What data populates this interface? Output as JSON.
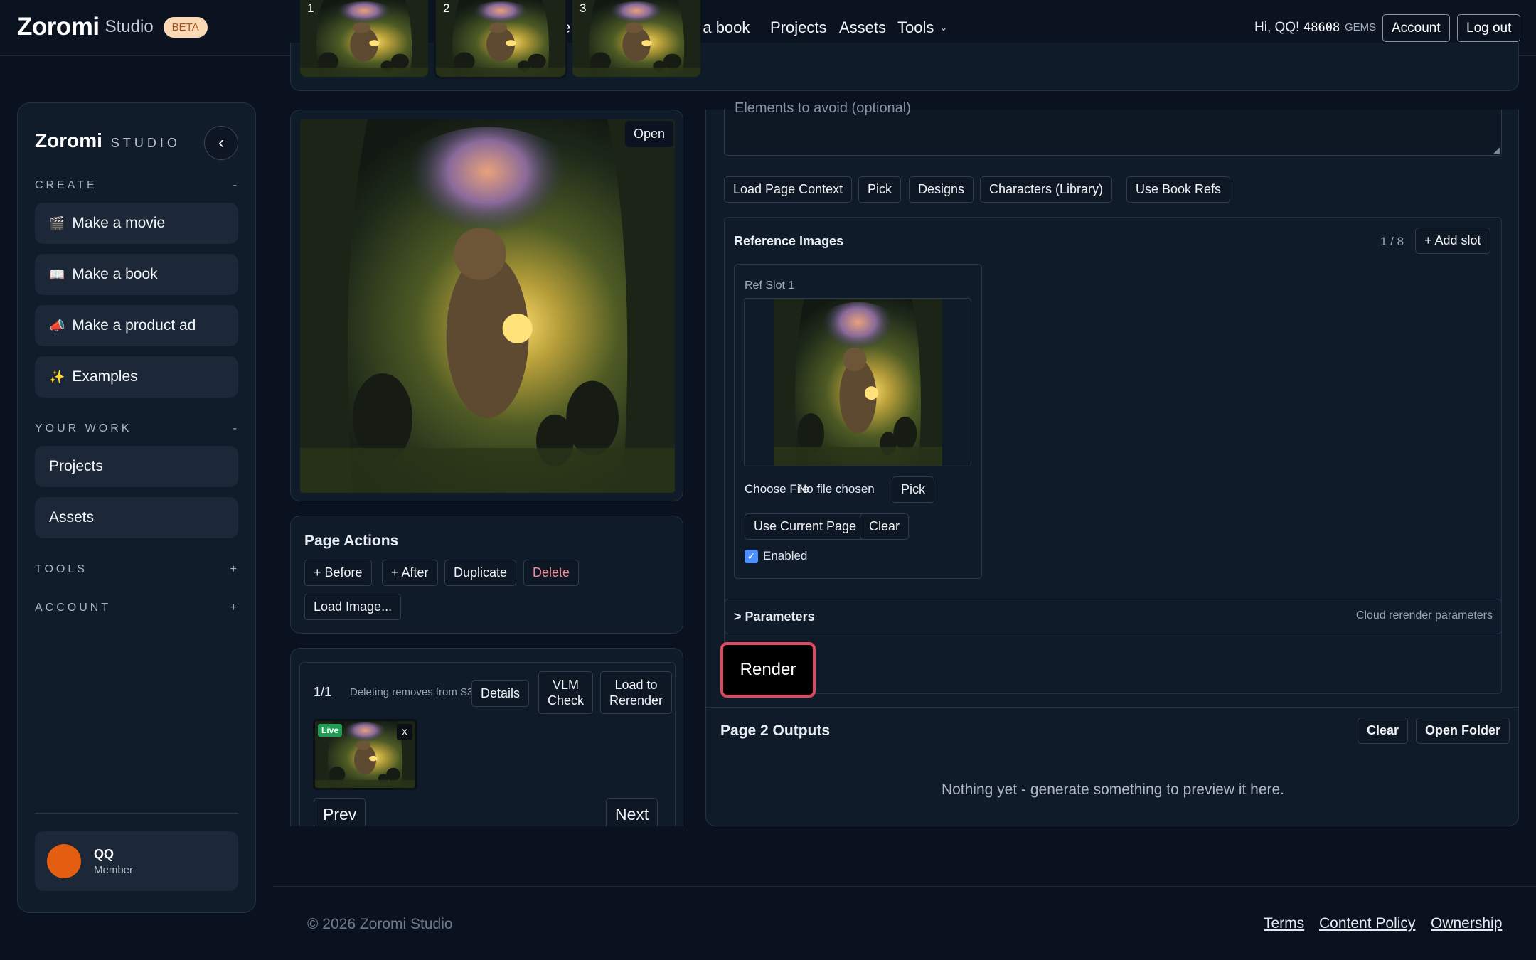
{
  "topbar": {
    "brand_name": "Zoromi",
    "brand_studio": "Studio",
    "beta_badge": "BETA",
    "nav_make_book": "e a book",
    "nav_make_movie_fragment": "e",
    "nav_projects": "Projects",
    "nav_assets": "Assets",
    "nav_tools": "Tools",
    "greeting": "Hi, QQ!",
    "gems_count": "48608",
    "gems_label": "GEMS",
    "account_label": "Account",
    "logout_label": "Log out"
  },
  "thumbnails": [
    {
      "num": "1"
    },
    {
      "num": "2"
    },
    {
      "num": "3"
    }
  ],
  "sidebar": {
    "brand_name": "Zoromi",
    "brand_studio": "STUDIO",
    "collapse_glyph": "‹",
    "create_heading": "CREATE",
    "create_toggle": "-",
    "create_items": [
      {
        "icon": "🎬",
        "label": "Make a movie"
      },
      {
        "icon": "📖",
        "label": "Make a book"
      },
      {
        "icon": "📣",
        "label": "Make a product ad"
      },
      {
        "icon": "✨",
        "label": "Examples"
      }
    ],
    "work_heading": "YOUR WORK",
    "work_toggle": "-",
    "work_items": [
      {
        "label": "Projects"
      },
      {
        "label": "Assets"
      }
    ],
    "tools_heading": "TOOLS",
    "tools_toggle": "+",
    "account_heading": "ACCOUNT",
    "account_toggle": "+",
    "user": {
      "name": "QQ",
      "role": "Member"
    }
  },
  "preview": {
    "open_label": "Open"
  },
  "page_actions": {
    "title": "Page Actions",
    "before": "+ Before",
    "after": "+ After",
    "duplicate": "Duplicate",
    "delete": "Delete",
    "load_image": "Load Image..."
  },
  "versions": {
    "counter": "1/1",
    "note": "Deleting removes from S3",
    "details": "Details",
    "vlm_check_line1": "VLM",
    "vlm_check_line2": "Check",
    "load_rerender_line1": "Load to",
    "load_rerender_line2": "Rerender",
    "live_badge": "Live",
    "remove": "x",
    "prev": "Prev",
    "next": "Next"
  },
  "editor": {
    "avoid_placeholder": "Elements to avoid (optional)",
    "tool_buttons": [
      "Load Page Context",
      "Pick",
      "Designs",
      "Characters (Library)",
      "Use Book Refs"
    ],
    "ref_title": "Reference Images",
    "ref_count": "1 / 8",
    "add_slot": "+ Add slot",
    "slot": {
      "title": "Ref Slot 1",
      "choose_file": "Choose File",
      "no_file": "No file chosen",
      "pick": "Pick",
      "use_current": "Use Current Page",
      "clear": "Clear",
      "enabled_label": "Enabled",
      "enabled": true
    },
    "params_title": "> Parameters",
    "params_hint": "Cloud rerender parameters",
    "render_label": "Render"
  },
  "outputs": {
    "title": "Page 2 Outputs",
    "clear": "Clear",
    "open_folder": "Open Folder",
    "empty": "Nothing yet - generate something to preview it here."
  },
  "footer": {
    "copyright": "© 2026 Zoromi Studio",
    "terms": "Terms",
    "content_policy": "Content Policy",
    "ownership": "Ownership"
  },
  "colors": {
    "background": "#0a1220",
    "panel": "#101b2a",
    "accent_live": "#1f9d55",
    "delete_text": "#f08a9a",
    "render_outline": "#e0475f",
    "avatar": "#e35e10"
  }
}
